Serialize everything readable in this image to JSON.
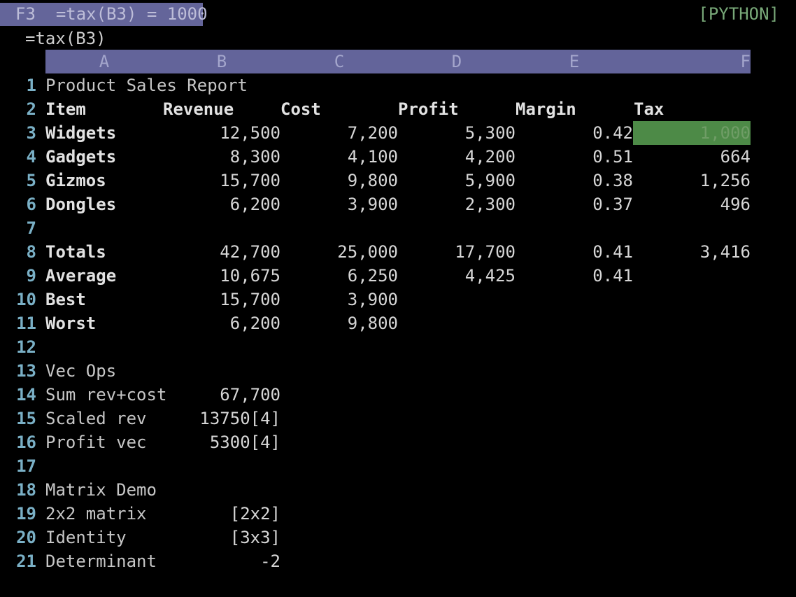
{
  "status": {
    "cell_ref": "F3",
    "cell_expr": "=tax(B3) = 1000",
    "mode": "[PYTHON]"
  },
  "formula_bar": "=tax(B3)",
  "columns": [
    "A",
    "B",
    "C",
    "D",
    "E",
    "F"
  ],
  "rows": [
    {
      "n": "1",
      "a": "Product Sales Report",
      "style": "plain",
      "v": [
        "",
        "",
        "",
        "",
        ""
      ]
    },
    {
      "n": "2",
      "a": "Item",
      "style": "bold",
      "header": true,
      "v": [
        "Revenue",
        "Cost",
        "Profit",
        "Margin",
        "Tax"
      ]
    },
    {
      "n": "3",
      "a": "Widgets",
      "style": "bold",
      "v": [
        "12,500",
        "7,200",
        "5,300",
        "0.42",
        "1,000"
      ]
    },
    {
      "n": "4",
      "a": "Gadgets",
      "style": "bold",
      "v": [
        "8,300",
        "4,100",
        "4,200",
        "0.51",
        "664"
      ]
    },
    {
      "n": "5",
      "a": "Gizmos",
      "style": "bold",
      "v": [
        "15,700",
        "9,800",
        "5,900",
        "0.38",
        "1,256"
      ]
    },
    {
      "n": "6",
      "a": "Dongles",
      "style": "bold",
      "v": [
        "6,200",
        "3,900",
        "2,300",
        "0.37",
        "496"
      ]
    },
    {
      "n": "7",
      "a": "",
      "style": "plain",
      "v": [
        "",
        "",
        "",
        "",
        ""
      ]
    },
    {
      "n": "8",
      "a": "Totals",
      "style": "bold",
      "v": [
        "42,700",
        "25,000",
        "17,700",
        "0.41",
        "3,416"
      ]
    },
    {
      "n": "9",
      "a": "Average",
      "style": "bold",
      "v": [
        "10,675",
        "6,250",
        "4,425",
        "0.41",
        ""
      ]
    },
    {
      "n": "10",
      "a": "Best",
      "style": "bold",
      "v": [
        "15,700",
        "3,900",
        "",
        "",
        ""
      ]
    },
    {
      "n": "11",
      "a": "Worst",
      "style": "bold",
      "v": [
        "6,200",
        "9,800",
        "",
        "",
        ""
      ]
    },
    {
      "n": "12",
      "a": "",
      "style": "plain",
      "v": [
        "",
        "",
        "",
        "",
        ""
      ]
    },
    {
      "n": "13",
      "a": "Vec Ops",
      "style": "plain",
      "v": [
        "",
        "",
        "",
        "",
        ""
      ]
    },
    {
      "n": "14",
      "a": "Sum rev+cost",
      "style": "plain",
      "v": [
        "67,700",
        "",
        "",
        "",
        ""
      ]
    },
    {
      "n": "15",
      "a": "Scaled rev",
      "style": "plain",
      "v": [
        "13750[4]",
        "",
        "",
        "",
        ""
      ]
    },
    {
      "n": "16",
      "a": "Profit vec",
      "style": "plain",
      "v": [
        "5300[4]",
        "",
        "",
        "",
        ""
      ]
    },
    {
      "n": "17",
      "a": "",
      "style": "plain",
      "v": [
        "",
        "",
        "",
        "",
        ""
      ]
    },
    {
      "n": "18",
      "a": "Matrix Demo",
      "style": "plain",
      "v": [
        "",
        "",
        "",
        "",
        ""
      ]
    },
    {
      "n": "19",
      "a": "2x2 matrix",
      "style": "plain",
      "v": [
        "[2x2]",
        "",
        "",
        "",
        ""
      ]
    },
    {
      "n": "20",
      "a": "Identity",
      "style": "plain",
      "v": [
        "[3x3]",
        "",
        "",
        "",
        ""
      ]
    },
    {
      "n": "21",
      "a": "Determinant",
      "style": "plain",
      "v": [
        "-2",
        "",
        "",
        "",
        ""
      ]
    }
  ],
  "selection": {
    "row": "3",
    "col": "F"
  },
  "colors": {
    "header_bg": "#63649a",
    "selection_bg": "#4d8a47",
    "row_number": "#7ab0c6",
    "mode_text": "#78a878"
  }
}
